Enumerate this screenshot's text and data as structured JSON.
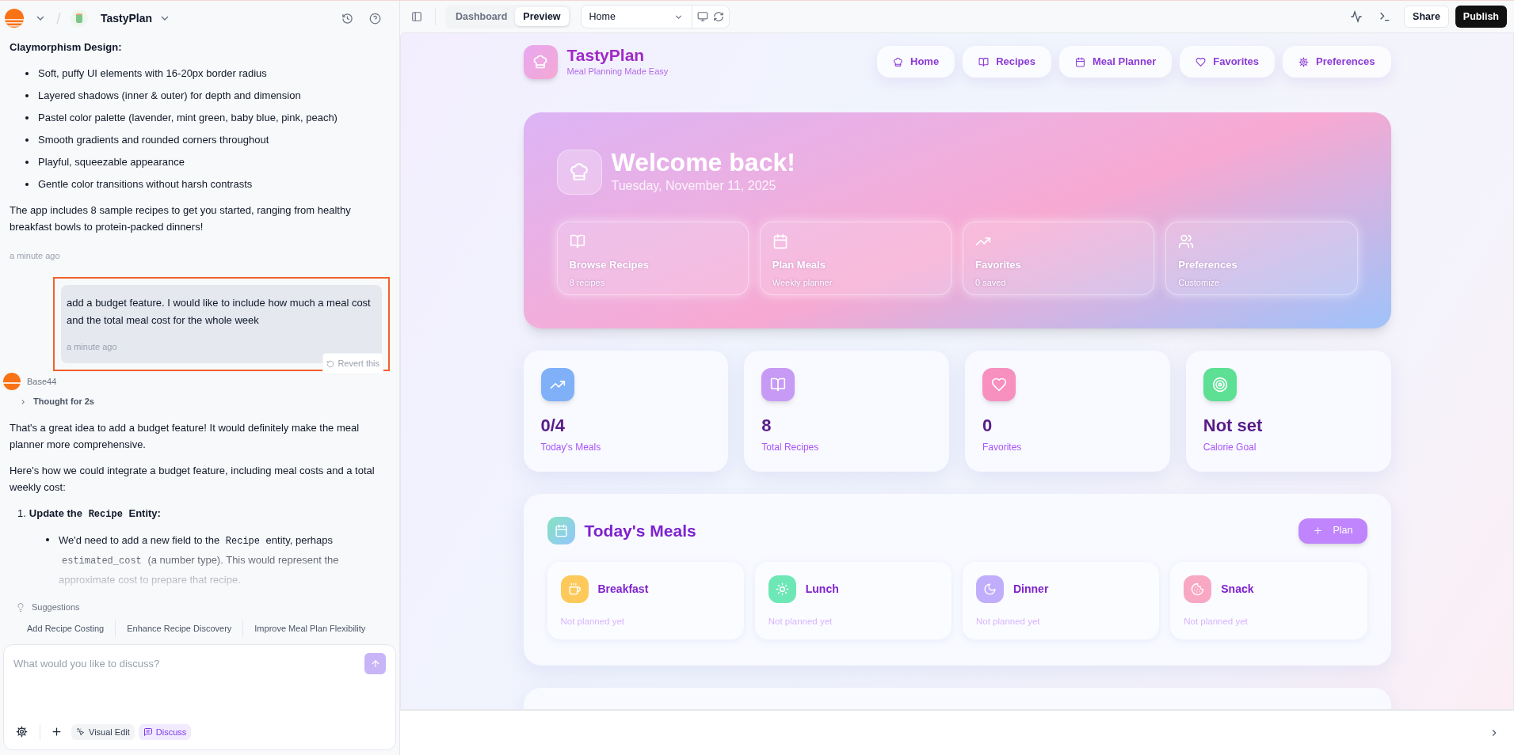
{
  "chat_header": {
    "project": "TastyPlan"
  },
  "chat": {
    "heading": "Claymorphism Design:",
    "bullets": [
      "Soft, puffy UI elements with 16-20px border radius",
      "Layered shadows (inner & outer) for depth and dimension",
      "Pastel color palette (lavender, mint green, baby blue, pink, peach)",
      "Smooth gradients and rounded corners throughout",
      "Playful, squeezable appearance",
      "Gentle color transitions without harsh contrasts"
    ],
    "paragraph": "The app includes 8 sample recipes to get you started, ranging from healthy breakfast bowls to protein-packed dinners!",
    "time": "a minute ago",
    "user_message": {
      "text": "add a budget feature. I would like to include how much a meal cost and the total meal cost for the whole week",
      "time": "a minute ago",
      "revert": "Revert this",
      "highlighted": true
    },
    "assistant": {
      "name": "Base44",
      "thought": "Thought for 2s",
      "paragraphs": [
        "That's a great idea to add a budget feature! It would definitely make the meal planner more comprehensive.",
        "Here's how we could integrate a budget feature, including meal costs and a total weekly cost:"
      ],
      "steps": [
        {
          "number": "1.",
          "title": [
            {
              "kind": "text",
              "text": "Update the"
            },
            {
              "kind": "code",
              "text": "Recipe"
            },
            {
              "kind": "text",
              "text": "Entity:"
            }
          ],
          "bullets": [
            [
              {
                "kind": "text",
                "text": "We'd need to add a new field to the"
              },
              {
                "kind": "code",
                "text": "Recipe"
              },
              {
                "kind": "text",
                "text": "entity, perhaps"
              },
              {
                "kind": "code",
                "text": "estimated_cost"
              },
              {
                "kind": "text",
                "text": "(a number type). This would represent the approximate cost to prepare that recipe."
              }
            ]
          ]
        }
      ]
    }
  },
  "suggestions": {
    "label": "Suggestions",
    "items": [
      "Add Recipe Costing",
      "Enhance Recipe Discovery",
      "Improve Meal Plan Flexibility"
    ]
  },
  "composer": {
    "placeholder": "What would you like to discuss?",
    "modes": [
      {
        "label": "Visual Edit",
        "kind": "sparkle",
        "selected": false
      },
      {
        "label": "Discuss",
        "kind": "message",
        "selected": true
      }
    ]
  },
  "toolbar": {
    "tabs": [
      {
        "label": "Dashboard",
        "selected": false
      },
      {
        "label": "Preview",
        "selected": true
      }
    ],
    "page": "Home",
    "share": "Share",
    "publish": "Publish"
  },
  "app": {
    "brand": "TastyPlan",
    "tagline": "Meal Planning Made Easy",
    "nav": [
      {
        "label": "Home",
        "kind": "chef"
      },
      {
        "label": "Recipes",
        "kind": "book"
      },
      {
        "label": "Meal Planner",
        "kind": "calendar"
      },
      {
        "label": "Favorites",
        "kind": "heart"
      },
      {
        "label": "Preferences",
        "kind": "gear"
      }
    ],
    "hero": {
      "title": "Welcome back!",
      "date": "Tuesday, November 11, 2025",
      "cards": [
        {
          "title": "Browse Recipes",
          "sub": "8 recipes",
          "kind": "book"
        },
        {
          "title": "Plan Meals",
          "sub": "Weekly planner",
          "kind": "calendar"
        },
        {
          "title": "Favorites",
          "sub": "0 saved",
          "kind": "trend"
        },
        {
          "title": "Preferences",
          "sub": "Customize",
          "kind": "users"
        }
      ]
    },
    "stats": [
      {
        "value": "0/4",
        "label": "Today's Meals",
        "kind": "trend",
        "color": "#7fb0f8"
      },
      {
        "value": "8",
        "label": "Total Recipes",
        "kind": "book",
        "color": "#c79af5"
      },
      {
        "value": "0",
        "label": "Favorites",
        "kind": "heart",
        "color": "#f78fbf"
      },
      {
        "value": "Not set",
        "label": "Calorie Goal",
        "kind": "target",
        "color": "#5ddf94"
      }
    ],
    "todays_meals": {
      "title": "Today's Meals",
      "button": "Plan",
      "meals": [
        {
          "name": "Breakfast",
          "status": "Not planned yet",
          "kind": "coffee",
          "color": "#fcc95a"
        },
        {
          "name": "Lunch",
          "status": "Not planned yet",
          "kind": "sun",
          "color": "#6ee7b7"
        },
        {
          "name": "Dinner",
          "status": "Not planned yet",
          "kind": "moon",
          "color": "#c0aefc"
        },
        {
          "name": "Snack",
          "status": "Not planned yet",
          "kind": "cookie",
          "color": "#f9a8c4"
        }
      ]
    }
  }
}
